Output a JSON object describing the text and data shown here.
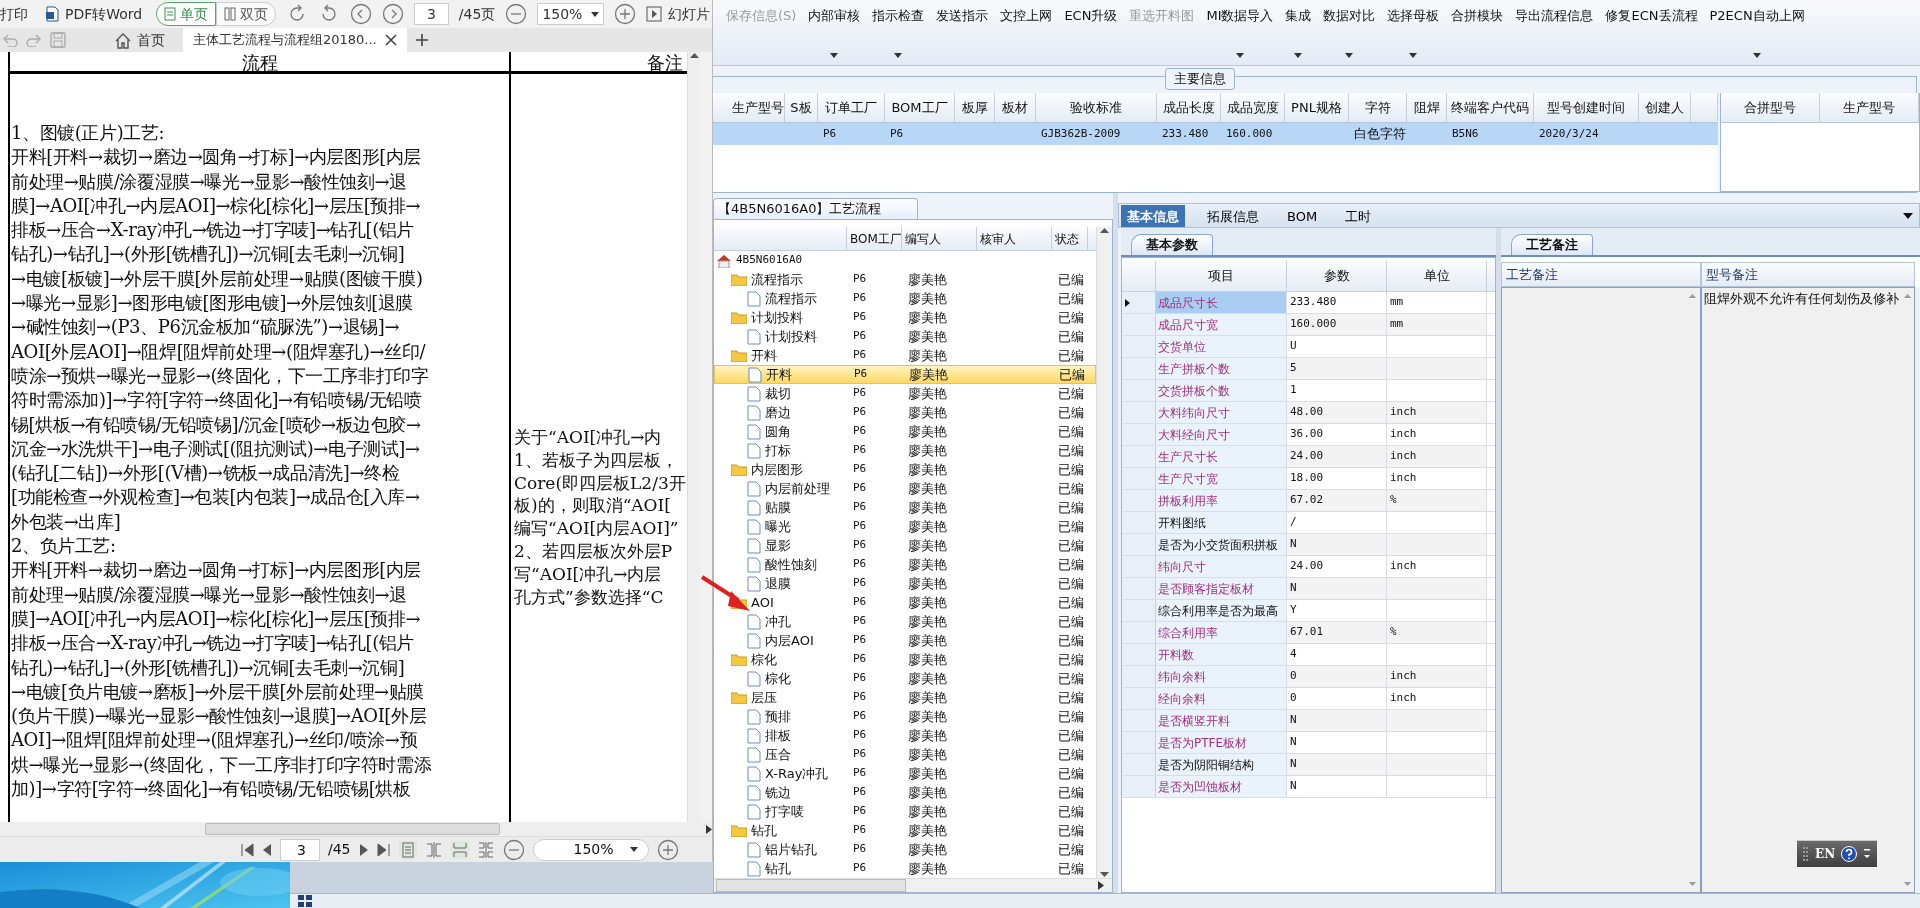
{
  "pdf_viewer": {
    "toolbar": {
      "print_label": "打印",
      "convert_label": "PDF转Word",
      "view_modes": [
        {
          "label": "单页",
          "selected": true
        },
        {
          "label": "双页",
          "selected": false
        }
      ],
      "page": "3",
      "page_total": "/45页",
      "zoom": "150%",
      "slideshow_label": "幻灯片"
    },
    "tabs": [
      {
        "kind": "home",
        "label": "首页",
        "selected": false
      },
      {
        "kind": "document",
        "label": "主体工艺流程与流程组20180...",
        "selected": true
      }
    ],
    "document": {
      "headers": [
        "流程",
        "备注"
      ],
      "left_lines": [
        "1、图镀(正片)工艺:",
        "开料[开料→裁切→磨边→圆角→打标]→内层图形[内层",
        "前处理→贴膜/涂覆湿膜→曝光→显影→酸性蚀刻→退",
        "膜]→AOI[冲孔→内层AOI]→棕化[棕化]→层压[预排→",
        "排板→压合→X-ray冲孔→铣边→打字唛]→钻孔[(铝片",
        "钻孔)→钻孔]→(外形[铣槽孔])→沉铜[去毛刺→沉铜]",
        "→电镀[板镀]→外层干膜[外层前处理→贴膜(图镀干膜)",
        "→曝光→显影]→图形电镀[图形电镀]→外层蚀刻[退膜",
        "→碱性蚀刻→(P3、P6沉金板加“硫脲洗”)→退锡]→",
        "AOI[外层AOI]→阻焊[阻焊前处理→(阻焊塞孔)→丝印/",
        "喷涂→预烘→曝光→显影→(终固化，下一工序非打印字",
        "符时需添加)]→字符[字符→终固化]→有铅喷锡/无铅喷",
        "锡[烘板→有铅喷锡/无铅喷锡]/沉金[喷砂→板边包胶→",
        "沉金→水洗烘干]→电子测试[(阻抗测试)→电子测试]→",
        "(钻孔[二钻])→外形[(V槽)→铣板→成品清洗]→终检",
        "[功能检查→外观检查]→包装[内包装]→成品仓[入库→",
        "外包装→出库]",
        "2、负片工艺:",
        "开料[开料→裁切→磨边→圆角→打标]→内层图形[内层",
        "前处理→贴膜/涂覆湿膜→曝光→显影→酸性蚀刻→退",
        "膜]→AOI[冲孔→内层AOI]→棕化[棕化]→层压[预排→",
        "排板→压合→X-ray冲孔→铣边→打字唛]→钻孔[(铝片",
        "钻孔)→钻孔]→(外形[铣槽孔])→沉铜[去毛刺→沉铜]",
        "→电镀[负片电镀→磨板]→外层干膜[外层前处理→贴膜",
        "(负片干膜)→曝光→显影→酸性蚀刻→退膜]→AOI[外层",
        "AOI]→阻焊[阻焊前处理→(阻焊塞孔)→丝印/喷涂→预",
        "烘→曝光→显影→(终固化，下一工序非打印字符时需添",
        "加)]→字符[字符→终固化]→有铅喷锡/无铅喷锡[烘板"
      ],
      "right_lines": [
        "关于“AOI[冲孔→内",
        "1、若板子为四层板，",
        "Core(即四层板L2/3开",
        "板)的，则取消“AOI[",
        "编写“AOI[内层AOI]”",
        "2、若四层板次外层P",
        "写“AOI[冲孔→内层",
        "孔方式”参数选择“C"
      ]
    },
    "bottom_bar": {
      "page": "3",
      "page_total": "/45",
      "zoom": "150%"
    }
  },
  "toolbar": [
    {
      "label": "保存信息(S)",
      "disabled": true,
      "has_menu": false
    },
    {
      "label": "内部审核",
      "disabled": false,
      "has_menu": true
    },
    {
      "label": "指示检查",
      "disabled": false,
      "has_menu": true
    },
    {
      "label": "发送指示",
      "disabled": false,
      "has_menu": false
    },
    {
      "label": "文控上网",
      "disabled": false,
      "has_menu": false
    },
    {
      "label": "ECN升级",
      "disabled": false,
      "has_menu": false
    },
    {
      "label": "重选开料图",
      "disabled": true,
      "has_menu": false
    },
    {
      "label": "MI数据导入",
      "disabled": false,
      "has_menu": true
    },
    {
      "label": "集成",
      "disabled": false,
      "has_menu": true
    },
    {
      "label": "数据对比",
      "disabled": false,
      "has_menu": true
    },
    {
      "label": "选择母板",
      "disabled": false,
      "has_menu": true
    },
    {
      "label": "合拼模块",
      "disabled": false,
      "has_menu": false
    },
    {
      "label": "导出流程信息",
      "disabled": false,
      "has_menu": false
    },
    {
      "label": "修复ECN丢流程",
      "disabled": false,
      "has_menu": false
    },
    {
      "label": "P2ECN自动上网",
      "disabled": false,
      "has_menu": true
    }
  ],
  "main_info": {
    "title": "主要信息",
    "columns": [
      "生产型号",
      "S板",
      "订单工厂",
      "BOM工厂",
      "板厚",
      "板材",
      "验收标准",
      "成品长度",
      "成品宽度",
      "PNL规格",
      "字符",
      "阻焊",
      "终端客户代码",
      "型号创建时间",
      "创建人"
    ],
    "rows": [
      {
        "selected": true,
        "cells": [
          null,
          null,
          "P6",
          "P6",
          null,
          null,
          "GJB362B-2009",
          "233.480",
          "160.000",
          null,
          "白色字符",
          null,
          "B5N6",
          "2020/3/24",
          null
        ]
      }
    ],
    "merge_columns": [
      "合拼型号",
      "生产型号"
    ]
  },
  "process_tree": {
    "title": "【4B5N6016A0】工艺流程",
    "columns": [
      "BOM工厂",
      "编写人",
      "核审人",
      "状态"
    ],
    "nodes": [
      {
        "kind": "root",
        "label": "4B5N6016A0",
        "selected": false,
        "children": [
          {
            "kind": "folder",
            "label": "流程指示",
            "bom": "P6",
            "writer": "廖美艳",
            "status": "已编",
            "selected": false,
            "children": [
              {
                "kind": "step",
                "label": "流程指示",
                "bom": "P6",
                "writer": "廖美艳",
                "status": "已编",
                "selected": false
              }
            ]
          },
          {
            "kind": "folder",
            "label": "计划投料",
            "bom": "P6",
            "writer": "廖美艳",
            "status": "已编",
            "selected": false,
            "children": [
              {
                "kind": "step",
                "label": "计划投料",
                "bom": "P6",
                "writer": "廖美艳",
                "status": "已编",
                "selected": false
              }
            ]
          },
          {
            "kind": "folder",
            "label": "开料",
            "bom": "P6",
            "writer": "廖美艳",
            "status": "已编",
            "selected": false,
            "children": [
              {
                "kind": "step",
                "label": "开料",
                "bom": "P6",
                "writer": "廖美艳",
                "status": "已编",
                "selected": true
              },
              {
                "kind": "step",
                "label": "裁切",
                "bom": "P6",
                "writer": "廖美艳",
                "status": "已编",
                "selected": false
              },
              {
                "kind": "step",
                "label": "磨边",
                "bom": "P6",
                "writer": "廖美艳",
                "status": "已编",
                "selected": false
              },
              {
                "kind": "step",
                "label": "圆角",
                "bom": "P6",
                "writer": "廖美艳",
                "status": "已编",
                "selected": false
              },
              {
                "kind": "step",
                "label": "打标",
                "bom": "P6",
                "writer": "廖美艳",
                "status": "已编",
                "selected": false
              }
            ]
          },
          {
            "kind": "folder",
            "label": "内层图形",
            "bom": "P6",
            "writer": "廖美艳",
            "status": "已编",
            "selected": false,
            "children": [
              {
                "kind": "step",
                "label": "内层前处理",
                "bom": "P6",
                "writer": "廖美艳",
                "status": "已编",
                "selected": false
              },
              {
                "kind": "step",
                "label": "贴膜",
                "bom": "P6",
                "writer": "廖美艳",
                "status": "已编",
                "selected": false
              },
              {
                "kind": "step",
                "label": "曝光",
                "bom": "P6",
                "writer": "廖美艳",
                "status": "已编",
                "selected": false
              },
              {
                "kind": "step",
                "label": "显影",
                "bom": "P6",
                "writer": "廖美艳",
                "status": "已编",
                "selected": false
              },
              {
                "kind": "step",
                "label": "酸性蚀刻",
                "bom": "P6",
                "writer": "廖美艳",
                "status": "已编",
                "selected": false
              },
              {
                "kind": "step",
                "label": "退膜",
                "bom": "P6",
                "writer": "廖美艳",
                "status": "已编",
                "selected": false
              }
            ]
          },
          {
            "kind": "folder",
            "label": "AOI",
            "bom": "P6",
            "writer": "廖美艳",
            "status": "已编",
            "selected": false,
            "children": [
              {
                "kind": "step",
                "label": "冲孔",
                "bom": "P6",
                "writer": "廖美艳",
                "status": "已编",
                "selected": false
              },
              {
                "kind": "step",
                "label": "内层AOI",
                "bom": "P6",
                "writer": "廖美艳",
                "status": "已编",
                "selected": false
              }
            ]
          },
          {
            "kind": "folder",
            "label": "棕化",
            "bom": "P6",
            "writer": "廖美艳",
            "status": "已编",
            "selected": false,
            "children": [
              {
                "kind": "step",
                "label": "棕化",
                "bom": "P6",
                "writer": "廖美艳",
                "status": "已编",
                "selected": false
              }
            ]
          },
          {
            "kind": "folder",
            "label": "层压",
            "bom": "P6",
            "writer": "廖美艳",
            "status": "已编",
            "selected": false,
            "children": [
              {
                "kind": "step",
                "label": "预排",
                "bom": "P6",
                "writer": "廖美艳",
                "status": "已编",
                "selected": false
              },
              {
                "kind": "step",
                "label": "排板",
                "bom": "P6",
                "writer": "廖美艳",
                "status": "已编",
                "selected": false
              },
              {
                "kind": "step",
                "label": "压合",
                "bom": "P6",
                "writer": "廖美艳",
                "status": "已编",
                "selected": false
              },
              {
                "kind": "step",
                "label": "X-Ray冲孔",
                "bom": "P6",
                "writer": "廖美艳",
                "status": "已编",
                "selected": false
              },
              {
                "kind": "step",
                "label": "铣边",
                "bom": "P6",
                "writer": "廖美艳",
                "status": "已编",
                "selected": false
              },
              {
                "kind": "step",
                "label": "打字唛",
                "bom": "P6",
                "writer": "廖美艳",
                "status": "已编",
                "selected": false
              }
            ]
          },
          {
            "kind": "folder",
            "label": "钻孔",
            "bom": "P6",
            "writer": "廖美艳",
            "status": "已编",
            "selected": false,
            "children": [
              {
                "kind": "step",
                "label": "铝片钻孔",
                "bom": "P6",
                "writer": "廖美艳",
                "status": "已编",
                "selected": false
              },
              {
                "kind": "step",
                "label": "钻孔",
                "bom": "P6",
                "writer": "廖美艳",
                "status": "已编",
                "selected": false
              }
            ]
          }
        ]
      }
    ]
  },
  "detail_tabs": [
    {
      "label": "基本信息",
      "selected": true
    },
    {
      "label": "拓展信息",
      "selected": false
    },
    {
      "label": "BOM",
      "selected": false
    },
    {
      "label": "工时",
      "selected": false
    }
  ],
  "params": {
    "subtab": "基本参数",
    "columns": [
      "项目",
      "参数",
      "单位"
    ],
    "rows": [
      {
        "item": "成品尺寸长",
        "value": "233.480",
        "unit": "mm",
        "highlighted": true,
        "selected": true
      },
      {
        "item": "成品尺寸宽",
        "value": "160.000",
        "unit": "mm",
        "highlighted": true,
        "selected": false
      },
      {
        "item": "交货单位",
        "value": "U",
        "highlighted": true,
        "selected": false
      },
      {
        "item": "生产拼板个数",
        "value": "5",
        "highlighted": true,
        "selected": false
      },
      {
        "item": "交货拼板个数",
        "value": "1",
        "highlighted": true,
        "selected": false
      },
      {
        "item": "大料纬向尺寸",
        "value": "48.00",
        "unit": "inch",
        "highlighted": true,
        "selected": false
      },
      {
        "item": "大料经向尺寸",
        "value": "36.00",
        "unit": "inch",
        "highlighted": true,
        "selected": false
      },
      {
        "item": "生产尺寸长",
        "value": "24.00",
        "unit": "inch",
        "highlighted": true,
        "selected": false
      },
      {
        "item": "生产尺寸宽",
        "value": "18.00",
        "unit": "inch",
        "highlighted": true,
        "selected": false
      },
      {
        "item": "拼板利用率",
        "value": "67.02",
        "unit": "%",
        "highlighted": true,
        "selected": false
      },
      {
        "item": "开料图纸",
        "value": "/",
        "highlighted": false,
        "selected": false
      },
      {
        "item": "是否为小交货面积拼板",
        "value": "N",
        "highlighted": false,
        "selected": false
      },
      {
        "item": "纬向尺寸",
        "value": "24.00",
        "unit": "inch",
        "highlighted": true,
        "selected": false
      },
      {
        "item": "是否顾客指定板材",
        "value": "N",
        "highlighted": true,
        "selected": false
      },
      {
        "item": "综合利用率是否为最高",
        "value": "Y",
        "highlighted": false,
        "selected": false
      },
      {
        "item": "综合利用率",
        "value": "67.01",
        "unit": "%",
        "highlighted": true,
        "selected": false
      },
      {
        "item": "开料数",
        "value": "4",
        "highlighted": true,
        "selected": false
      },
      {
        "item": "纬向余料",
        "value": "0",
        "unit": "inch",
        "highlighted": true,
        "selected": false
      },
      {
        "item": "经向余料",
        "value": "0",
        "unit": "inch",
        "highlighted": true,
        "selected": false
      },
      {
        "item": "是否横竖开料",
        "value": "N",
        "highlighted": true,
        "selected": false
      },
      {
        "item": "是否为PTFE板材",
        "value": "N",
        "highlighted": true,
        "selected": false
      },
      {
        "item": "是否为阴阳铜结构",
        "value": "N",
        "highlighted": false,
        "selected": false
      },
      {
        "item": "是否为凹蚀板材",
        "value": "N",
        "highlighted": true,
        "selected": false
      }
    ]
  },
  "remarks": {
    "subtab": "工艺备注",
    "columns": [
      "工艺备注",
      "型号备注"
    ],
    "model_note": "阻焊外观不允许有任何划伤及修补"
  },
  "language_bar": {
    "label": "EN"
  }
}
